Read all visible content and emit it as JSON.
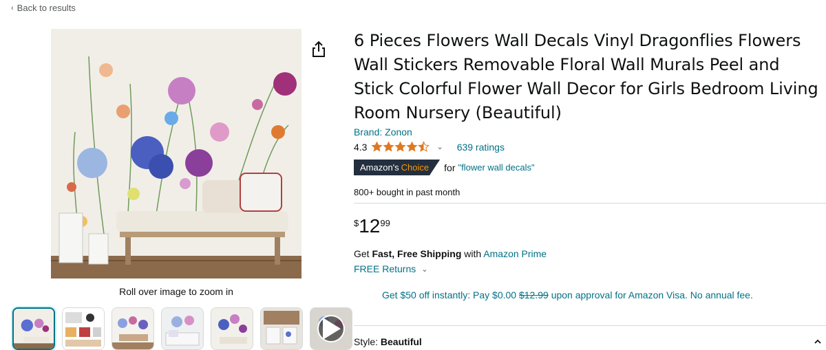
{
  "nav": {
    "back_label": "Back to results"
  },
  "gallery": {
    "zoom_hint": "Roll over image to zoom in",
    "thumbnail_count": 7,
    "selected_index": 0
  },
  "product": {
    "title": "6 Pieces Flowers Wall Decals Vinyl Dragonflies Flowers Wall Stickers Removable Floral Wall Murals Peel and Stick Colorful Flower Wall Decor for Girls Bedroom Living Room Nursery (Beautiful)",
    "brand": "Brand: Zonon",
    "rating_value": "4.3",
    "rating_stars": 4.3,
    "ratings_count": "639 ratings",
    "badge_prefix": "Amazon's",
    "badge_word": "Choice",
    "badge_for": "for",
    "badge_keyword": "\"flower wall decals\"",
    "bought": "800+ bought in past month",
    "price_symbol": "$",
    "price_whole": "12",
    "price_fraction": "99"
  },
  "shipping": {
    "prefix": "Get ",
    "bold": "Fast, Free Shipping",
    "middle": " with ",
    "prime_link": "Amazon Prime",
    "returns_label": "FREE Returns"
  },
  "promo": {
    "before": "Get $50 off instantly: Pay $0.00 ",
    "struck": "$12.99",
    "after": " upon approval for Amazon Visa. No annual fee."
  },
  "style": {
    "label": "Style: ",
    "value": "Beautiful"
  },
  "colors": {
    "link": "#007185",
    "star": "#de7921",
    "badge_bg": "#232f3e",
    "badge_accent": "#ff9900",
    "text": "#0f1111",
    "muted": "#565959"
  }
}
